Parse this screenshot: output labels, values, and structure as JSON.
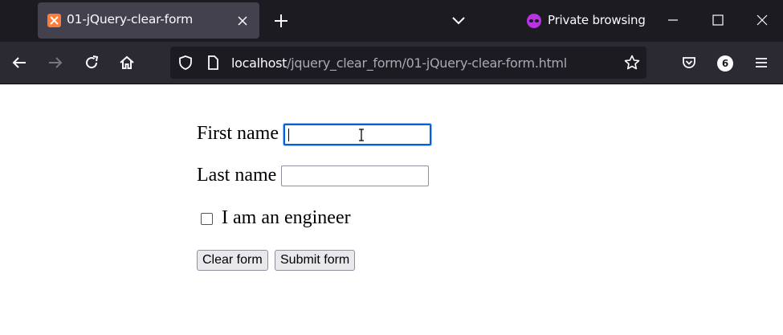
{
  "browser": {
    "tab": {
      "title": "01-jQuery-clear-form",
      "favicon_color": "#fb7d3c"
    },
    "private_label": "Private browsing",
    "url": {
      "host": "localhost",
      "path": "/jquery_clear_form/01-jQuery-clear-form.html"
    },
    "extensions_badge": "6",
    "accent_color": "#0060df"
  },
  "form": {
    "first_name_label": "First name",
    "first_name_value": "",
    "last_name_label": "Last name",
    "last_name_value": "",
    "engineer_label": "I am an engineer",
    "engineer_checked": false,
    "clear_button": "Clear form",
    "submit_button": "Submit form"
  }
}
